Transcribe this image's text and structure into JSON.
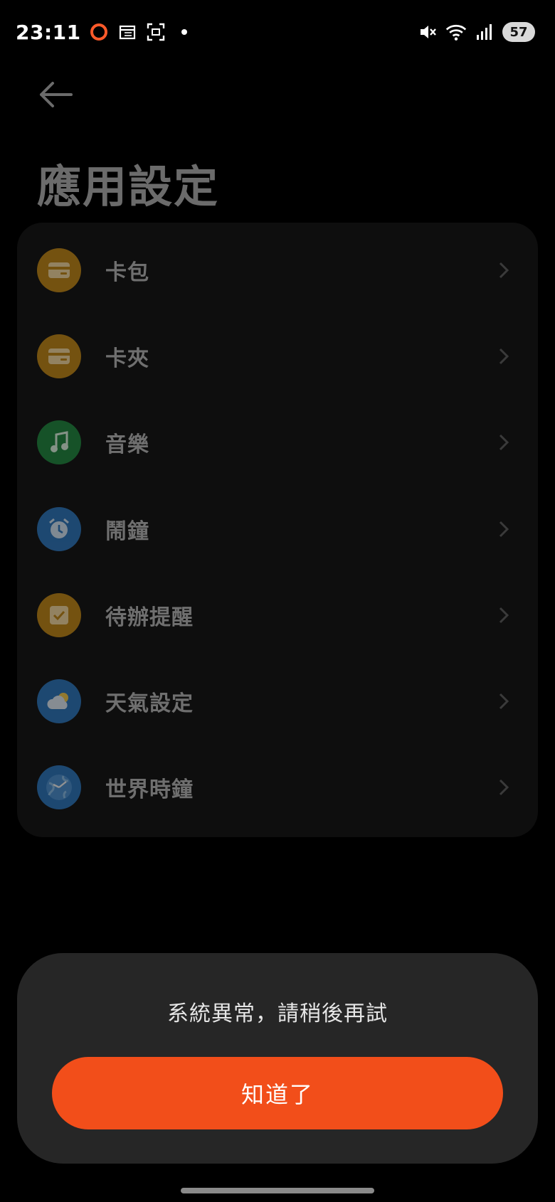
{
  "status_bar": {
    "time": "23:11",
    "battery": "57",
    "icons_left": [
      "record-icon",
      "calendar-icon",
      "screenshot-icon",
      "dot-icon"
    ],
    "icons_right": [
      "mute-icon",
      "wifi-icon",
      "signal-icon",
      "battery-icon"
    ]
  },
  "header": {
    "title": "應用設定"
  },
  "list": {
    "items": [
      {
        "label": "卡包",
        "icon": "card-icon",
        "color": "#c98a12"
      },
      {
        "label": "卡夾",
        "icon": "card-icon",
        "color": "#c98a12"
      },
      {
        "label": "音樂",
        "icon": "music-note-icon",
        "color": "#1e8a3e"
      },
      {
        "label": "鬧鐘",
        "icon": "alarm-clock-icon",
        "color": "#2b78c2"
      },
      {
        "label": "待辦提醒",
        "icon": "checkbox-icon",
        "color": "#c98a12"
      },
      {
        "label": "天氣設定",
        "icon": "weather-icon",
        "color": "#2b78c2"
      },
      {
        "label": "世界時鐘",
        "icon": "world-clock-icon",
        "color": "#2b78c2"
      }
    ]
  },
  "dialog": {
    "message": "系統異常，請稍後再試",
    "confirm_label": "知道了",
    "confirm_color": "#f24e1a"
  }
}
